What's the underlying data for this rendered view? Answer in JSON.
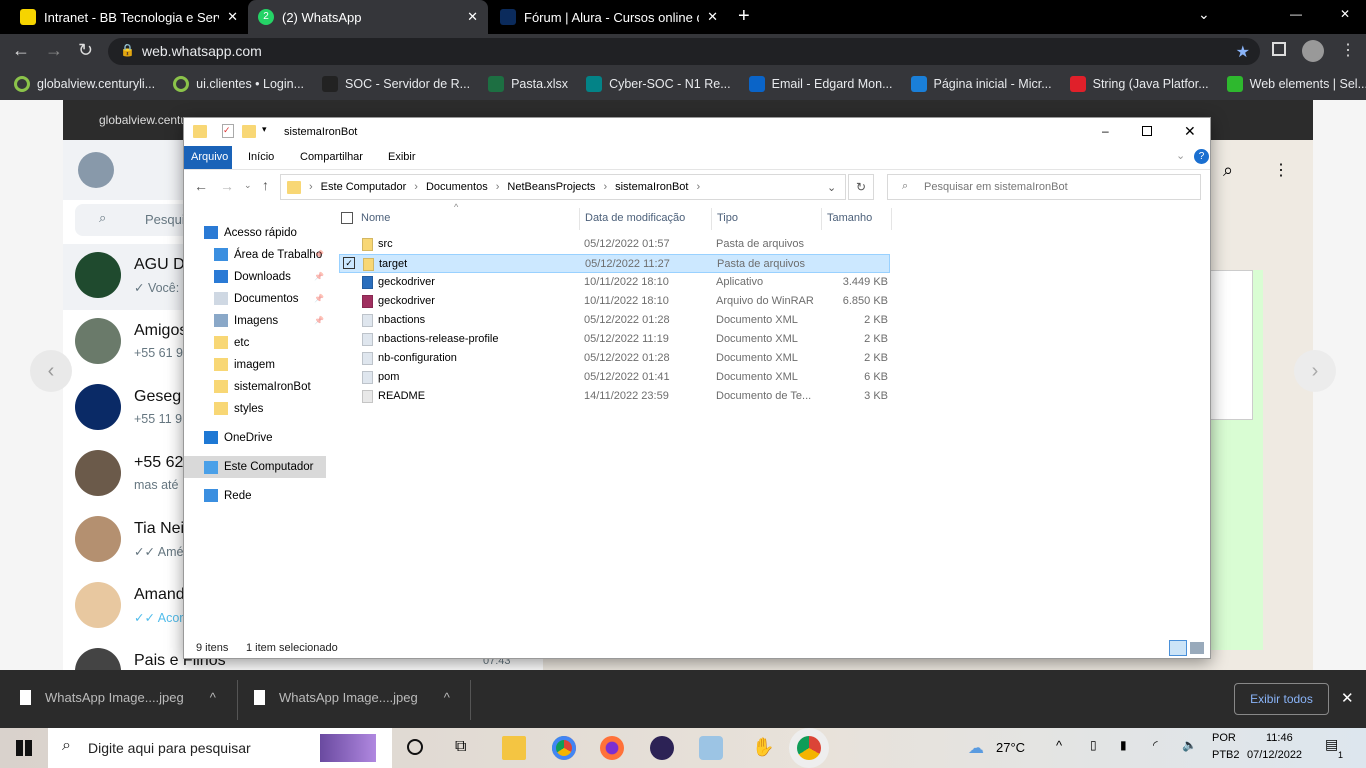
{
  "browser": {
    "tabs": [
      {
        "title": "Intranet - BB Tecnologia e Serviços",
        "icon": "bb-icon"
      },
      {
        "title": "(2) WhatsApp",
        "icon": "whatsapp-icon",
        "badge": "2"
      },
      {
        "title": "Fórum | Alura - Cursos online de",
        "icon": "alura-icon"
      }
    ],
    "url": "web.whatsapp.com",
    "bookmarks": [
      "globalview.centuryli...",
      "ui.clientes • Login...",
      "SOC - Servidor de R...",
      "Pasta.xlsx",
      "Cyber-SOC - N1 Re...",
      "Email - Edgard Mon...",
      "Página inicial - Micr...",
      "String (Java Platfor...",
      "Web elements | Sel..."
    ],
    "more": "»"
  },
  "whatsapp": {
    "inner_bookmark": "globalview.centur",
    "search_placeholder": "Pesquisa",
    "chats": [
      {
        "name": "AGU De",
        "msg": "✓ Você:"
      },
      {
        "name": "Amigos",
        "msg": "+55 61 9"
      },
      {
        "name": "Geseg",
        "msg": "+55 11 9"
      },
      {
        "name": "+55 62",
        "msg": "mas até"
      },
      {
        "name": "Tia Nei",
        "msg": "✓✓ Amér"
      },
      {
        "name": "Amand",
        "msg": "✓✓ Acord"
      },
      {
        "name": "Pais e Filhos",
        "msg": "",
        "time": "07:43"
      }
    ],
    "message_lines": [
      "ns,",
      "nte.",
      "e erro.",
      "a",
      "ve",
      "truir o",
      "erar",
      "meu",
      "o jar.",
      "ode"
    ],
    "message_time": "11:58 ✓"
  },
  "explorer": {
    "title": "sistemaIronBot",
    "ribbon": [
      "Arquivo",
      "Início",
      "Compartilhar",
      "Exibir"
    ],
    "breadcrumb": [
      "Este Computador",
      "Documentos",
      "NetBeansProjects",
      "sistemaIronBot"
    ],
    "search_placeholder": "Pesquisar em sistemaIronBot",
    "nav": [
      {
        "label": "Acesso rápido",
        "type": "star"
      },
      {
        "label": "Área de Trabalho",
        "type": "desktop",
        "pin": true
      },
      {
        "label": "Downloads",
        "type": "download",
        "pin": true
      },
      {
        "label": "Documentos",
        "type": "doc",
        "pin": true
      },
      {
        "label": "Imagens",
        "type": "image",
        "pin": true
      },
      {
        "label": "etc",
        "type": "folder"
      },
      {
        "label": "imagem",
        "type": "folder"
      },
      {
        "label": "sistemaIronBot",
        "type": "folder"
      },
      {
        "label": "styles",
        "type": "folder"
      },
      {
        "label": "OneDrive",
        "type": "cloud"
      },
      {
        "label": "Este Computador",
        "type": "pc",
        "selected": true
      },
      {
        "label": "Rede",
        "type": "network"
      }
    ],
    "columns": [
      "Nome",
      "Data de modificação",
      "Tipo",
      "Tamanho"
    ],
    "files": [
      {
        "name": "src",
        "date": "05/12/2022 01:57",
        "type": "Pasta de arquivos",
        "size": "",
        "icon": "folder"
      },
      {
        "name": "target",
        "date": "05/12/2022 11:27",
        "type": "Pasta de arquivos",
        "size": "",
        "icon": "folder",
        "selected": true
      },
      {
        "name": "geckodriver",
        "date": "10/11/2022 18:10",
        "type": "Aplicativo",
        "size": "3.449 KB",
        "icon": "exe"
      },
      {
        "name": "geckodriver",
        "date": "10/11/2022 18:10",
        "type": "Arquivo do WinRAR",
        "size": "6.850 KB",
        "icon": "rar"
      },
      {
        "name": "nbactions",
        "date": "05/12/2022 01:28",
        "type": "Documento XML",
        "size": "2 KB",
        "icon": "xml"
      },
      {
        "name": "nbactions-release-profile",
        "date": "05/12/2022 11:19",
        "type": "Documento XML",
        "size": "2 KB",
        "icon": "xml"
      },
      {
        "name": "nb-configuration",
        "date": "05/12/2022 01:28",
        "type": "Documento XML",
        "size": "2 KB",
        "icon": "xml"
      },
      {
        "name": "pom",
        "date": "05/12/2022 01:41",
        "type": "Documento XML",
        "size": "6 KB",
        "icon": "xml"
      },
      {
        "name": "README",
        "date": "14/11/2022 23:59",
        "type": "Documento de Te...",
        "size": "3 KB",
        "icon": "txt"
      }
    ],
    "status_count": "9 itens",
    "status_selected": "1 item selecionado"
  },
  "downloads": {
    "items": [
      "WhatsApp Image....jpeg",
      "WhatsApp Image....jpeg"
    ],
    "show_all": "Exibir todos"
  },
  "taskbar": {
    "search_placeholder": "Digite aqui para pesquisar",
    "weather": "27°C",
    "lang1": "POR",
    "lang2": "PTB2",
    "time": "11:46",
    "date": "07/12/2022",
    "notifications": "1"
  }
}
